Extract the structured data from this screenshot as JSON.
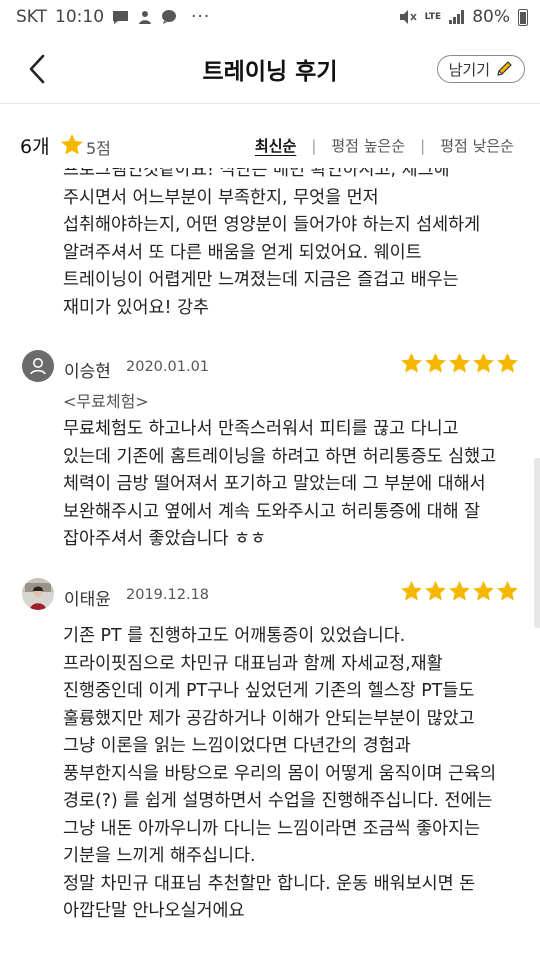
{
  "status_bar": {
    "carrier": "SKT",
    "time": "10:10",
    "dots": "···",
    "network": "LTE",
    "battery": "80%"
  },
  "header": {
    "title": "트레이닝 후기",
    "write_label": "남기기"
  },
  "summary": {
    "count": "6개",
    "score": "5점",
    "sort_options": [
      "최신순",
      "평점 높은순",
      "평점 낮은순"
    ],
    "separators": [
      "|",
      "|"
    ]
  },
  "top_partial_text": "프로그램인것같아요! 식단은 매번 확인하시고, 체크해\n주시면서 어느부분이 부족한지, 무엇을 먼저\n섭취해야하는지, 어떤 영양분이 들어가야 하는지 섬세하게\n알려주셔서 또 다른 배움을 얻게 되었어요. 웨이트\n트레이닝이 어렵게만 느껴졌는데 지금은 즐겁고 배우는\n재미가 있어요! 강추",
  "reviews": [
    {
      "name": "이승현",
      "date": "2020.01.01",
      "rating": 5,
      "tag": "<무료체험>",
      "body": "무료체험도 하고나서 만족스러워서 피티를 끊고 다니고\n있는데 기존에 홈트레이닝을 하려고 하면 허리통증도 심했고\n체력이 금방 떨어져서 포기하고 말았는데 그 부분에 대해서\n보완해주시고 옆에서 계속 도와주시고 허리통증에 대해 잘\n잡아주셔서 좋았습니다 ㅎㅎ"
    },
    {
      "name": "이태윤",
      "date": "2019.12.18",
      "rating": 5,
      "body": "기존 PT 를 진행하고도 어깨통증이 있었습니다.\n프라이핏짐으로 차민규 대표님과 함께 자세교정,재활\n진행중인데 이게 PT구나 싶었던게 기존의 헬스장 PT들도\n훌륭했지만 제가 공감하거나 이해가 안되는부분이 많았고\n그냥 이론을 읽는 느낌이었다면 다년간의 경험과\n풍부한지식을 바탕으로 우리의 몸이 어떻게 움직이며 근육의\n경로(?) 를 쉽게 설명하면서 수업을 진행해주십니다. 전에는\n그냥 내돈 아까우니까 다니는 느낌이라면 조금씩 좋아지는\n기분을 느끼게 해주십니다.\n정말 차민규 대표님 추천할만 합니다. 운동 배워보시면 돈\n아깝단말 안나오실거에요"
    }
  ],
  "colors": {
    "star": "#F5B800",
    "text": "#222222",
    "border": "#E5E5E5"
  }
}
